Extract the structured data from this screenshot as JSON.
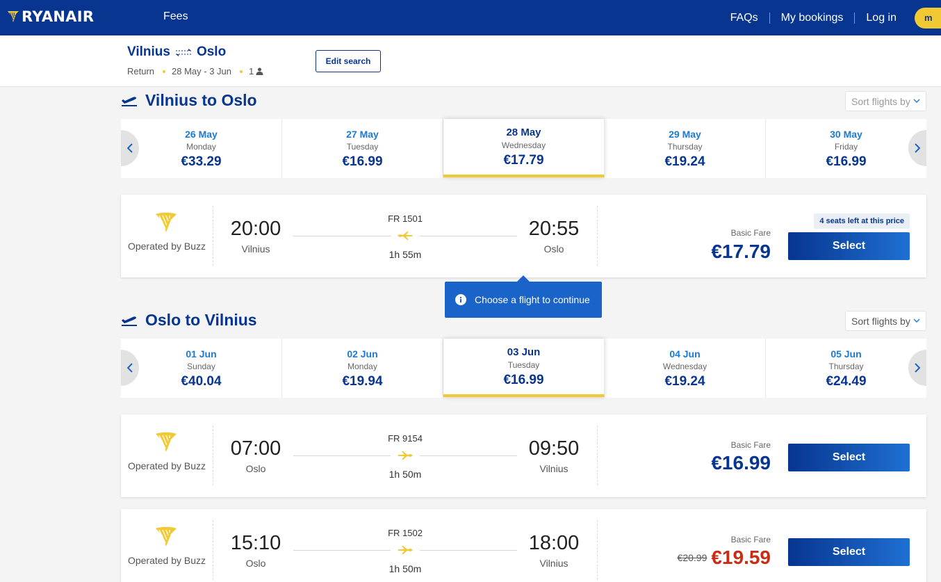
{
  "header": {
    "brand": "RYANAIR",
    "nav_fees": "Fees",
    "nav_faqs": "FAQs",
    "nav_bookings": "My bookings",
    "nav_login": "Log in",
    "avatar_initial": "m"
  },
  "summary": {
    "origin": "Vilnius",
    "destination": "Oslo",
    "trip_type": "Return",
    "dates": "28 May - 3 Jun",
    "passengers": "1",
    "edit_label": "Edit search"
  },
  "outbound": {
    "title": "Vilnius to Oslo",
    "sort_label": "Sort flights by",
    "dates": [
      {
        "date": "26 May",
        "day": "Monday",
        "price": "€33.29"
      },
      {
        "date": "27 May",
        "day": "Tuesday",
        "price": "€16.99"
      },
      {
        "date": "28 May",
        "day": "Wednesday",
        "price": "€17.79"
      },
      {
        "date": "29 May",
        "day": "Thursday",
        "price": "€19.24"
      },
      {
        "date": "30 May",
        "day": "Friday",
        "price": "€16.99"
      }
    ],
    "flights": [
      {
        "operator": "Operated by Buzz",
        "dep_time": "20:00",
        "dep_city": "Vilnius",
        "arr_time": "20:55",
        "arr_city": "Oslo",
        "flight_no": "FR 1501",
        "duration": "1h 55m",
        "fare_label": "Basic Fare",
        "price": "€17.79",
        "seats_badge": "4 seats left at this price",
        "select_label": "Select"
      }
    ]
  },
  "tooltip": {
    "text": "Choose a flight to continue"
  },
  "inbound": {
    "title": "Oslo to Vilnius",
    "sort_label": "Sort flights by",
    "dates": [
      {
        "date": "01 Jun",
        "day": "Sunday",
        "price": "€40.04"
      },
      {
        "date": "02 Jun",
        "day": "Monday",
        "price": "€19.94"
      },
      {
        "date": "03 Jun",
        "day": "Tuesday",
        "price": "€16.99"
      },
      {
        "date": "04 Jun",
        "day": "Wednesday",
        "price": "€19.24"
      },
      {
        "date": "05 Jun",
        "day": "Thursday",
        "price": "€24.49"
      }
    ],
    "flights": [
      {
        "operator": "Operated by Buzz",
        "dep_time": "07:00",
        "dep_city": "Oslo",
        "arr_time": "09:50",
        "arr_city": "Vilnius",
        "flight_no": "FR 9154",
        "duration": "1h 50m",
        "fare_label": "Basic Fare",
        "price": "€16.99",
        "select_label": "Select"
      },
      {
        "operator": "Operated by Buzz",
        "dep_time": "15:10",
        "dep_city": "Oslo",
        "arr_time": "18:00",
        "arr_city": "Vilnius",
        "flight_no": "FR 1502",
        "duration": "1h 50m",
        "fare_label": "Basic Fare",
        "old_price": "€20.99",
        "price": "€19.59",
        "select_label": "Select"
      }
    ]
  },
  "colors": {
    "brand_blue": "#073590",
    "accent_yellow": "#f1c933",
    "link_blue": "#1a7ad4",
    "sale_red": "#c82d16"
  },
  "icons": [
    "harp-logo-icon",
    "flight-route-icon",
    "person-icon",
    "takeoff-icon",
    "chevron-down-icon",
    "chevron-left-icon",
    "chevron-right-icon",
    "plane-icon",
    "info-icon"
  ]
}
